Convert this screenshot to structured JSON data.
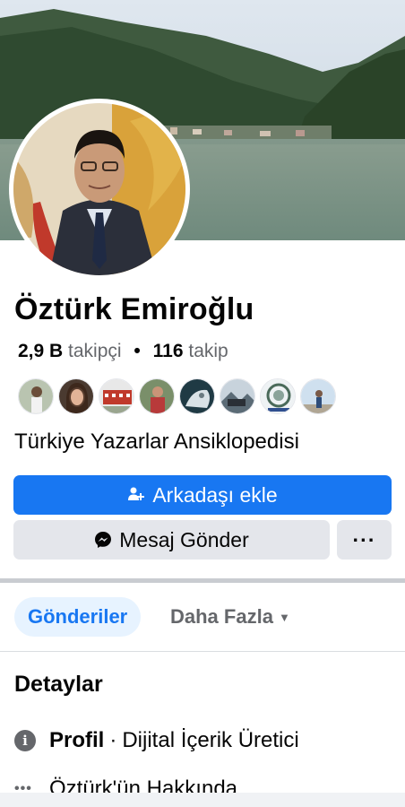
{
  "profile": {
    "name": "Öztürk Emiroğlu",
    "followers_value": "2,9 B",
    "followers_label": "takipçi",
    "separator": "•",
    "following_value": "116",
    "following_label": "takip",
    "bio": "Türkiye Yazarlar Ansiklopedisi",
    "mutual_friends_count": 8
  },
  "actions": {
    "add_friend_label": "Arkadaşı ekle",
    "message_label": "Mesaj Gönder",
    "more_label": "···"
  },
  "tabs": {
    "active_label": "Gönderiler",
    "more_label": "Daha Fazla"
  },
  "details": {
    "title": "Detaylar",
    "profile_label": "Profil",
    "profile_separator": "·",
    "profile_value": "Dijital İçerik Üretici",
    "about_label": "Öztürk'ün Hakkında"
  },
  "colors": {
    "primary": "#1877f2",
    "secondary_button": "#e4e6eb",
    "tab_active_bg": "#e7f3ff",
    "text_secondary": "#65676b"
  },
  "icons": {
    "add_friend": "person-plus-icon",
    "messenger": "messenger-icon",
    "info": "info-icon",
    "more": "ellipsis-icon",
    "caret": "caret-down-icon"
  }
}
